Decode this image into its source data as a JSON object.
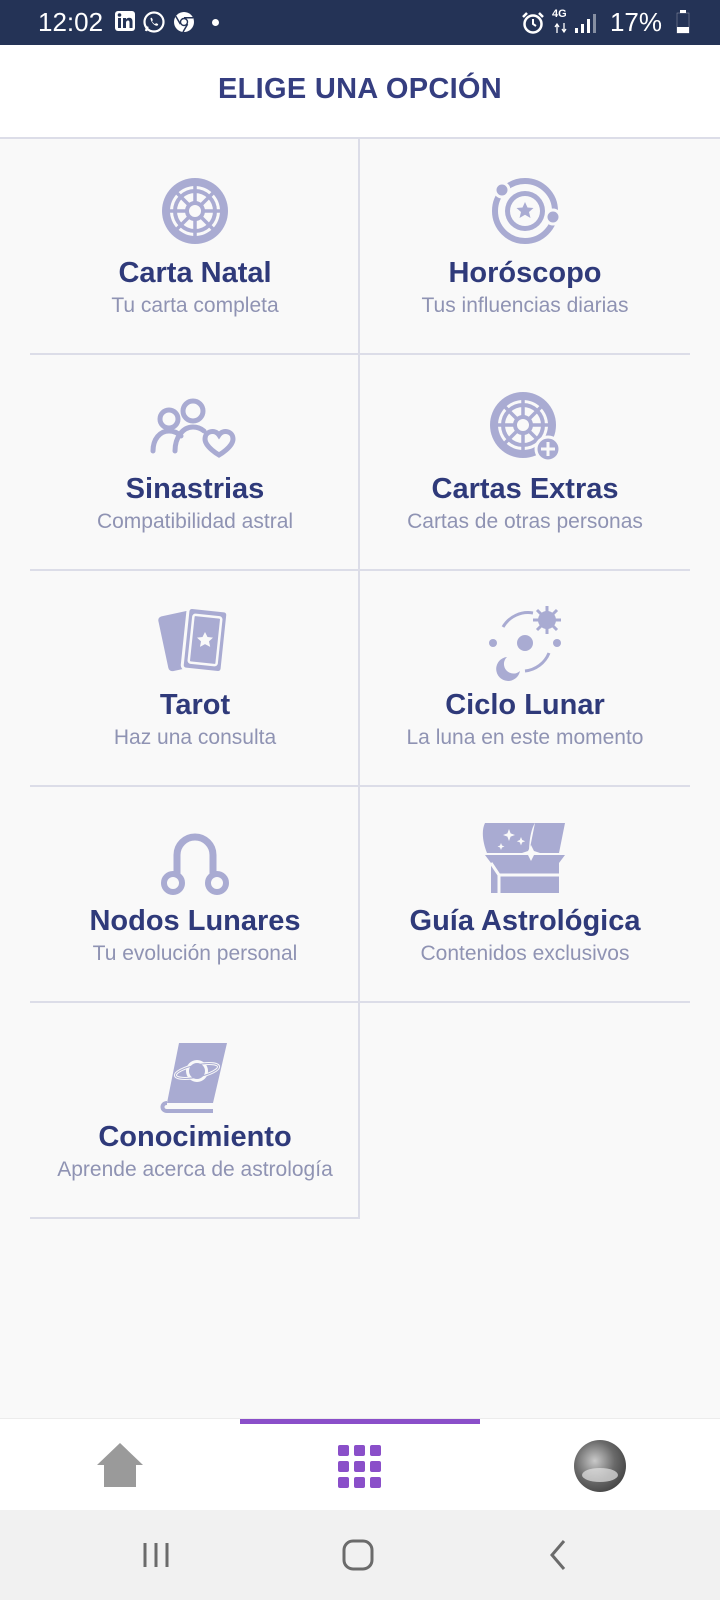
{
  "status_bar": {
    "time": "12:02",
    "battery": "17%",
    "network": "4G",
    "icons": [
      "linkedin-icon",
      "whatsapp-icon",
      "chrome-icon",
      "alarm-icon",
      "signal-icon",
      "battery-icon"
    ]
  },
  "header": {
    "title": "ELIGE UNA OPCIÓN"
  },
  "menu": {
    "items": [
      {
        "title": "Carta Natal",
        "subtitle": "Tu carta completa",
        "icon": "natal-chart-wheel-icon"
      },
      {
        "title": "Horóscopo",
        "subtitle": "Tus influencias diarias",
        "icon": "horoscope-orbit-icon"
      },
      {
        "title": "Sinastrias",
        "subtitle": "Compatibilidad astral",
        "icon": "couple-hearts-icon"
      },
      {
        "title": "Cartas Extras",
        "subtitle": "Cartas de otras personas",
        "icon": "chart-wheel-plus-icon"
      },
      {
        "title": "Tarot",
        "subtitle": "Haz una consulta",
        "icon": "tarot-cards-icon"
      },
      {
        "title": "Ciclo Lunar",
        "subtitle": "La luna en este momento",
        "icon": "moon-cycle-icon"
      },
      {
        "title": "Nodos Lunares",
        "subtitle": "Tu evolución personal",
        "icon": "lunar-nodes-icon"
      },
      {
        "title": "Guía Astrológica",
        "subtitle": "Contenidos exclusivos",
        "icon": "treasure-chest-icon"
      },
      {
        "title": "Conocimiento",
        "subtitle": "Aprende acerca de astrología",
        "icon": "book-planet-icon"
      }
    ]
  },
  "bottom_nav": {
    "items": [
      {
        "icon": "home-icon",
        "active": false
      },
      {
        "icon": "grid-menu-icon",
        "active": true
      },
      {
        "icon": "profile-avatar",
        "active": false
      }
    ]
  },
  "colors": {
    "status_bar_bg": "#243356",
    "title": "#2f3a7a",
    "subtitle": "#8f93b3",
    "icon": "#a9abd2",
    "active_nav": "#8a4fc9",
    "inactive_nav": "#9a9a9a"
  }
}
